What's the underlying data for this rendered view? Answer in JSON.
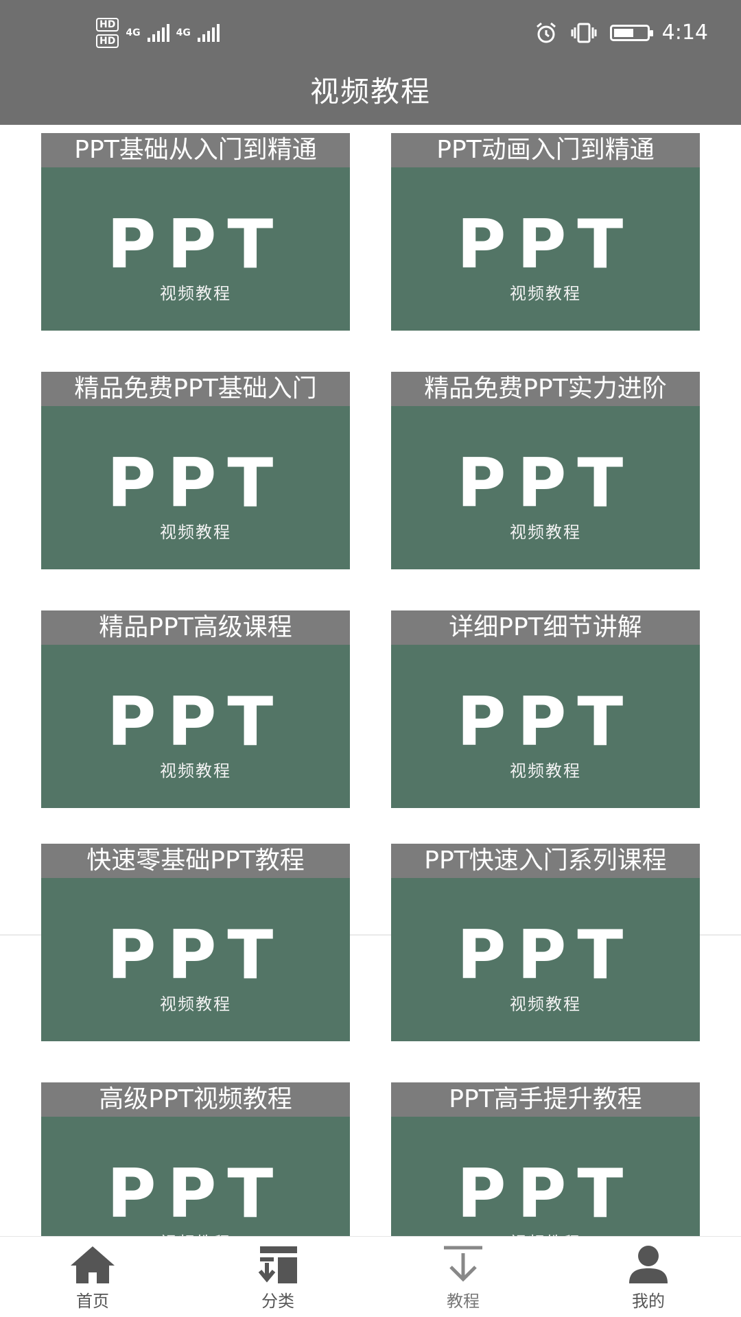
{
  "status_bar": {
    "sim1": "HD",
    "sim2": "HD",
    "network1": "4G",
    "network2": "4G",
    "time": "4:14"
  },
  "app_bar": {
    "title": "视频教程"
  },
  "cards": [
    {
      "title": "PPT基础从入门到精通",
      "logo": "PPT",
      "subtitle": "视频教程"
    },
    {
      "title": "PPT动画入门到精通",
      "logo": "PPT",
      "subtitle": "视频教程"
    },
    {
      "title": "精品免费PPT基础入门",
      "logo": "PPT",
      "subtitle": "视频教程"
    },
    {
      "title": "精品免费PPT实力进阶",
      "logo": "PPT",
      "subtitle": "视频教程"
    },
    {
      "title": "精品PPT高级课程",
      "logo": "PPT",
      "subtitle": "视频教程"
    },
    {
      "title": "详细PPT细节讲解",
      "logo": "PPT",
      "subtitle": "视频教程"
    },
    {
      "title": "快速零基础PPT教程",
      "logo": "PPT",
      "subtitle": "视频教程"
    },
    {
      "title": "PPT快速入门系列课程",
      "logo": "PPT",
      "subtitle": "视频教程"
    },
    {
      "title": "高级PPT视频教程",
      "logo": "PPT",
      "subtitle": "视频教程"
    },
    {
      "title": "PPT高手提升教程",
      "logo": "PPT",
      "subtitle": "视频教程"
    }
  ],
  "tabs": [
    {
      "label": "首页",
      "icon": "home-icon"
    },
    {
      "label": "分类",
      "icon": "category-icon"
    },
    {
      "label": "教程",
      "icon": "tutorial-icon"
    },
    {
      "label": "我的",
      "icon": "profile-icon"
    }
  ],
  "colors": {
    "bar_background": "#6f6f6f",
    "card_green": "#537566",
    "card_title_background": "#7c7c7c"
  }
}
